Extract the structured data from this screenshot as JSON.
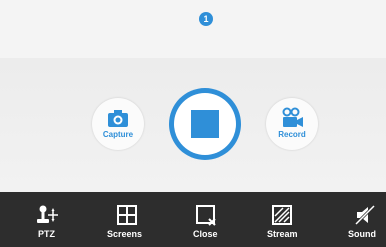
{
  "page_indicator": {
    "current": "1"
  },
  "controls": {
    "capture_label": "Capture",
    "record_label": "Record",
    "stop_icon": "stop-square-icon"
  },
  "toolbar": {
    "items": [
      {
        "label": "PTZ",
        "icon": "ptz-joystick-icon"
      },
      {
        "label": "Screens",
        "icon": "grid-layout-icon"
      },
      {
        "label": "Close",
        "icon": "close-window-icon"
      },
      {
        "label": "Stream",
        "icon": "stream-icon"
      },
      {
        "label": "Sound",
        "icon": "sound-muted-icon"
      }
    ]
  },
  "colors": {
    "accent": "#2f8fd8",
    "toolbar_bg": "#2d2d2d",
    "background": "#eeeeee"
  }
}
